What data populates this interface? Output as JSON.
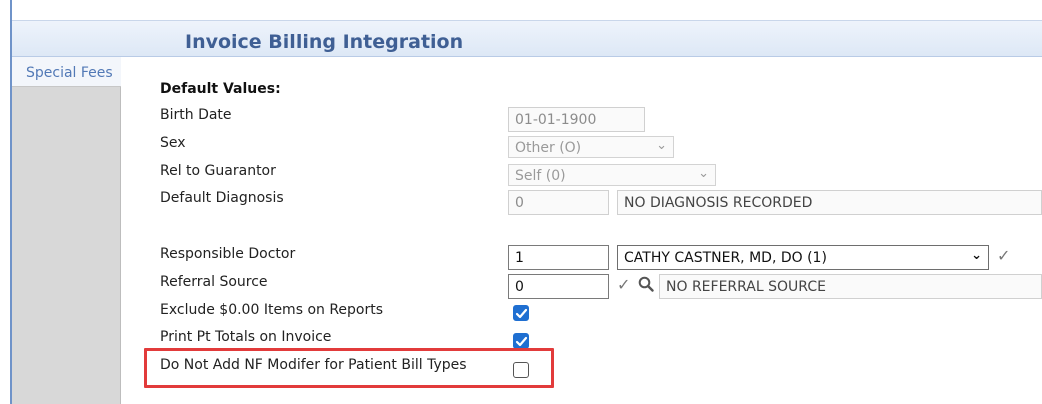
{
  "header": {
    "title": "Invoice Billing Integration"
  },
  "sidebar": {
    "items": [
      {
        "label": "Special Fees"
      }
    ]
  },
  "form": {
    "section_title": "Default Values:",
    "birth_date": {
      "label": "Birth Date",
      "value": "01-01-1900"
    },
    "sex": {
      "label": "Sex",
      "value": "Other (O)"
    },
    "rel_to_guarantor": {
      "label": "Rel to Guarantor",
      "value": "Self (0)"
    },
    "default_diagnosis": {
      "label": "Default Diagnosis",
      "code": "0",
      "description": "NO DIAGNOSIS RECORDED"
    },
    "responsible_doctor": {
      "label": "Responsible Doctor",
      "code": "1",
      "name": "CATHY CASTNER, MD, DO (1)"
    },
    "referral_source": {
      "label": "Referral Source",
      "code": "0",
      "description": "NO REFERRAL SOURCE"
    },
    "exclude_zero_items": {
      "label": "Exclude $0.00 Items on Reports",
      "checked": true
    },
    "print_pt_totals": {
      "label": "Print Pt Totals on Invoice",
      "checked": true
    },
    "no_nf_modifier": {
      "label": "Do Not Add NF Modifer for Patient Bill Types",
      "checked": false
    }
  },
  "colors": {
    "accent": "#1f6fd1",
    "highlight": "#e23b3b",
    "header_text": "#3f5f94",
    "sidebar_link": "#5279b6"
  },
  "icons": {
    "confirm": "check-icon",
    "lookup": "search-icon",
    "dropdown": "chevron-down-icon"
  }
}
